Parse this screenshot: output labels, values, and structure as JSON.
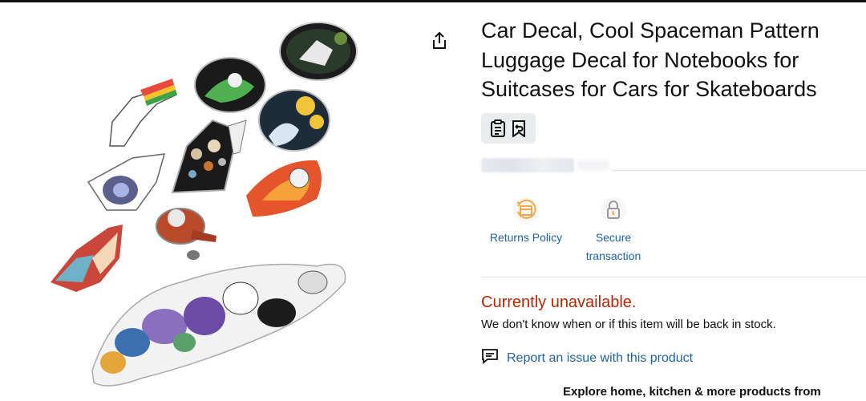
{
  "product": {
    "title_line1": "Car Decal, Cool Spaceman Pattern",
    "title_line2": "Luggage Decal for Notebooks for",
    "title_line3": "Suitcases for Cars for Skateboards"
  },
  "icons": {
    "share": "share-icon",
    "clipboard": "clipboard-list-icon",
    "bookmark": "bookmark-return-icon",
    "returns": "returns-box-icon",
    "secure": "lock-icon",
    "report": "chat-report-icon"
  },
  "features": {
    "returns_label": "Returns Policy",
    "secure_label_line1": "Secure",
    "secure_label_line2": "transaction"
  },
  "availability": {
    "status": "Currently unavailable.",
    "note": "We don't know when or if this item will be back in stock."
  },
  "report": {
    "label": "Report an issue with this product"
  },
  "explore": {
    "text": "Explore home, kitchen & more products from"
  },
  "colors": {
    "link": "#2162a1",
    "unavailable": "#b12704",
    "text": "#0f1111",
    "chip_bg": "#eaeded",
    "returns_icon_accent": "#f3a847"
  }
}
